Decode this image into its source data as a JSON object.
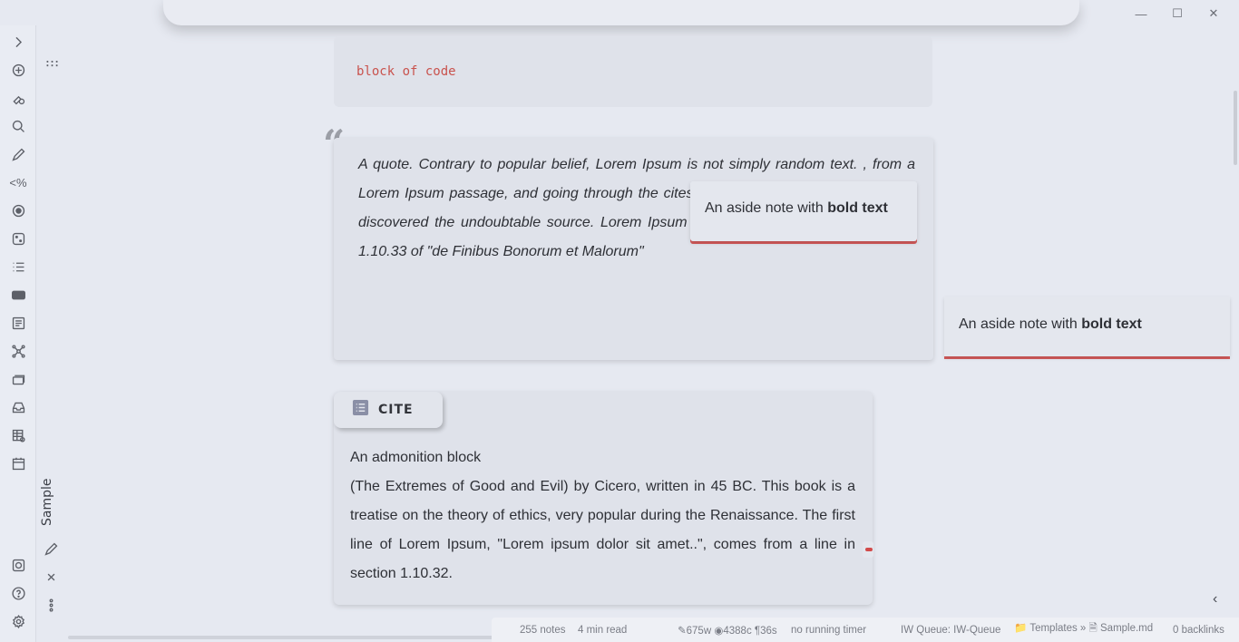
{
  "window": {
    "minimize_glyph": "—",
    "maximize_glyph": "☐",
    "close_glyph": "✕"
  },
  "ribbon": {
    "icons": [
      "expand-chevron-icon",
      "new-note-icon",
      "graph-pin-icon",
      "search-icon",
      "pencil-icon",
      "template-icon",
      "record-icon",
      "dice-icon",
      "list-icon",
      "markdown-icon",
      "document-icon",
      "network-icon",
      "cards-icon",
      "inbox-icon",
      "table-icon",
      "calendar-icon",
      "vault-icon",
      "help-icon",
      "settings-icon"
    ],
    "template_label": "<%",
    "calendar_day": "1"
  },
  "sidebar": {
    "tab_label": "Sample"
  },
  "content": {
    "code": "block of code",
    "quote_mark": "“",
    "quote": "A quote. Contrary to popular belief, Lorem Ipsum is not simply random text. , from a Lorem Ipsum passage, and going through the cites of the word in classical literature, discovered the undoubtable source. Lorem Ipsum comes from sections 1.10.32 and 1.10.33 of \"de Finibus Bonorum et Malorum\"",
    "aside_prefix": "An aside note with",
    "aside_bold": "bold text",
    "admonition_title": "CITE",
    "admonition_line1": "An admonition block",
    "admonition_body": "(The Extremes of Good and Evil) by Cicero, written in 45 BC. This book is a treatise on the theory of ethics, very popular during the Renaissance. The first line of Lorem Ipsum, \"Lorem ipsum dolor sit amet..\", comes from a line in section 1.10.32."
  },
  "statusbar": {
    "notes": "255 notes",
    "read": "4 min read",
    "stats": "675w ◉4388c ¶36s",
    "timer": "no running timer",
    "queue": "IW Queue: IW-Queue",
    "breadcrumb_folder": "Templates »",
    "breadcrumb_file": "Sample.md",
    "backlinks": "0 backlinks"
  },
  "colors": {
    "accent": "#d45b5b",
    "code": "#c9524d",
    "background": "#e6e9f1",
    "block": "#dfe2ea"
  }
}
